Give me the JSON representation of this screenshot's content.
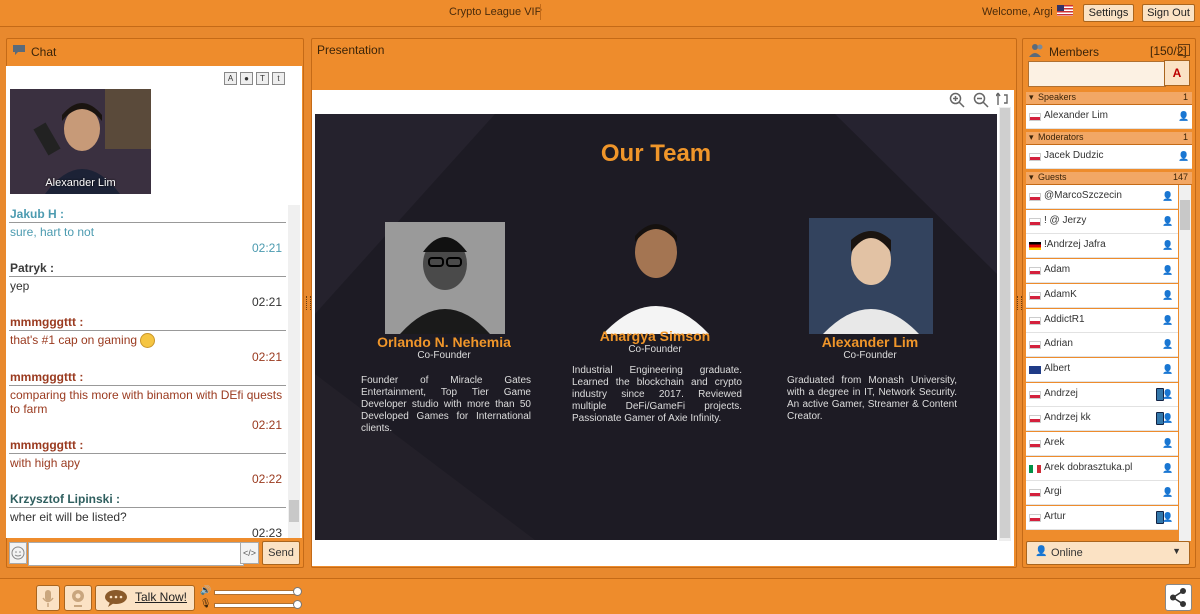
{
  "header": {
    "app_title": "Crypto League VIP",
    "welcome": "Welcome, Argi",
    "settings_label": "Settings",
    "signout_label": "Sign Out"
  },
  "chat": {
    "title": "Chat",
    "video_name": "Alexander Lim",
    "messages": [
      {
        "name": "Jakub H :",
        "text": "sure, hart to not",
        "time": "02:21"
      },
      {
        "name": "Patryk :",
        "text": "yep",
        "time": "02:21"
      },
      {
        "name": "mmmgggttt :",
        "text": "that's #1 cap on gaming",
        "time": "02:21"
      },
      {
        "name": "mmmgggttt :",
        "text": "comparing this more with binamon with DEfi quests to farm",
        "time": "02:21"
      },
      {
        "name": "mmmgggttt :",
        "text": "with high apy",
        "time": "02:22"
      },
      {
        "name": "Krzysztof Lipinski :",
        "text": "wher eit will be listed?",
        "time": "02:23"
      }
    ],
    "send_label": "Send"
  },
  "presentation": {
    "title": "Presentation",
    "slide": {
      "heading": "Our Team",
      "people": [
        {
          "name": "Orlando N. Nehemia",
          "role": "Co-Founder",
          "bio": "Founder of Miracle Gates Entertainment, Top Tier Game Developer studio with more than 50 Developed Games for International clients."
        },
        {
          "name": "Anargya Simson",
          "role": "Co-Founder",
          "bio": "Industrial Engineering graduate. Learned the blockchain and crypto industry since 2017. Reviewed multiple DeFi/GameFi projects. Passionate Gamer of Axie Infinity."
        },
        {
          "name": "Alexander Lim",
          "role": "Co-Founder",
          "bio": "Graduated from Monash University, with a degree in IT, Network Security. An active Gamer, Streamer & Content Creator."
        }
      ]
    }
  },
  "members": {
    "title": "Members",
    "count": "[150/2]",
    "font_label": "A",
    "sections": {
      "speakers": {
        "label": "Speakers",
        "count": "1"
      },
      "moderators": {
        "label": "Moderators",
        "count": "1"
      },
      "guests": {
        "label": "Guests",
        "count": "147"
      }
    },
    "speakers": [
      {
        "name": "Alexander Lim",
        "flag": "pl"
      }
    ],
    "moderators": [
      {
        "name": "Jacek Dudzic",
        "flag": "pl"
      }
    ],
    "guests": [
      {
        "name": "@MarcoSzczecin",
        "flag": "pl",
        "cam": false
      },
      {
        "name": "! @ Jerzy",
        "flag": "pl",
        "cam": false
      },
      {
        "name": "!Andrzej Jafra",
        "flag": "de",
        "cam": false
      },
      {
        "name": "Adam",
        "flag": "pl",
        "cam": false
      },
      {
        "name": "AdamK",
        "flag": "pl",
        "cam": false
      },
      {
        "name": "AddictR1",
        "flag": "pl",
        "cam": false
      },
      {
        "name": "Adrian",
        "flag": "pl",
        "cam": false
      },
      {
        "name": "Albert",
        "flag": "gb",
        "cam": false
      },
      {
        "name": "Andrzej",
        "flag": "pl",
        "cam": true
      },
      {
        "name": "Andrzej kk",
        "flag": "pl",
        "cam": true
      },
      {
        "name": "Arek",
        "flag": "pl",
        "cam": false
      },
      {
        "name": "Arek dobrasztuka.pl",
        "flag": "it",
        "cam": false
      },
      {
        "name": "Argi",
        "flag": "pl",
        "cam": false
      },
      {
        "name": "Artur",
        "flag": "pl",
        "cam": true
      }
    ],
    "status": "Online"
  },
  "footer": {
    "talk_label": "Talk Now!"
  }
}
